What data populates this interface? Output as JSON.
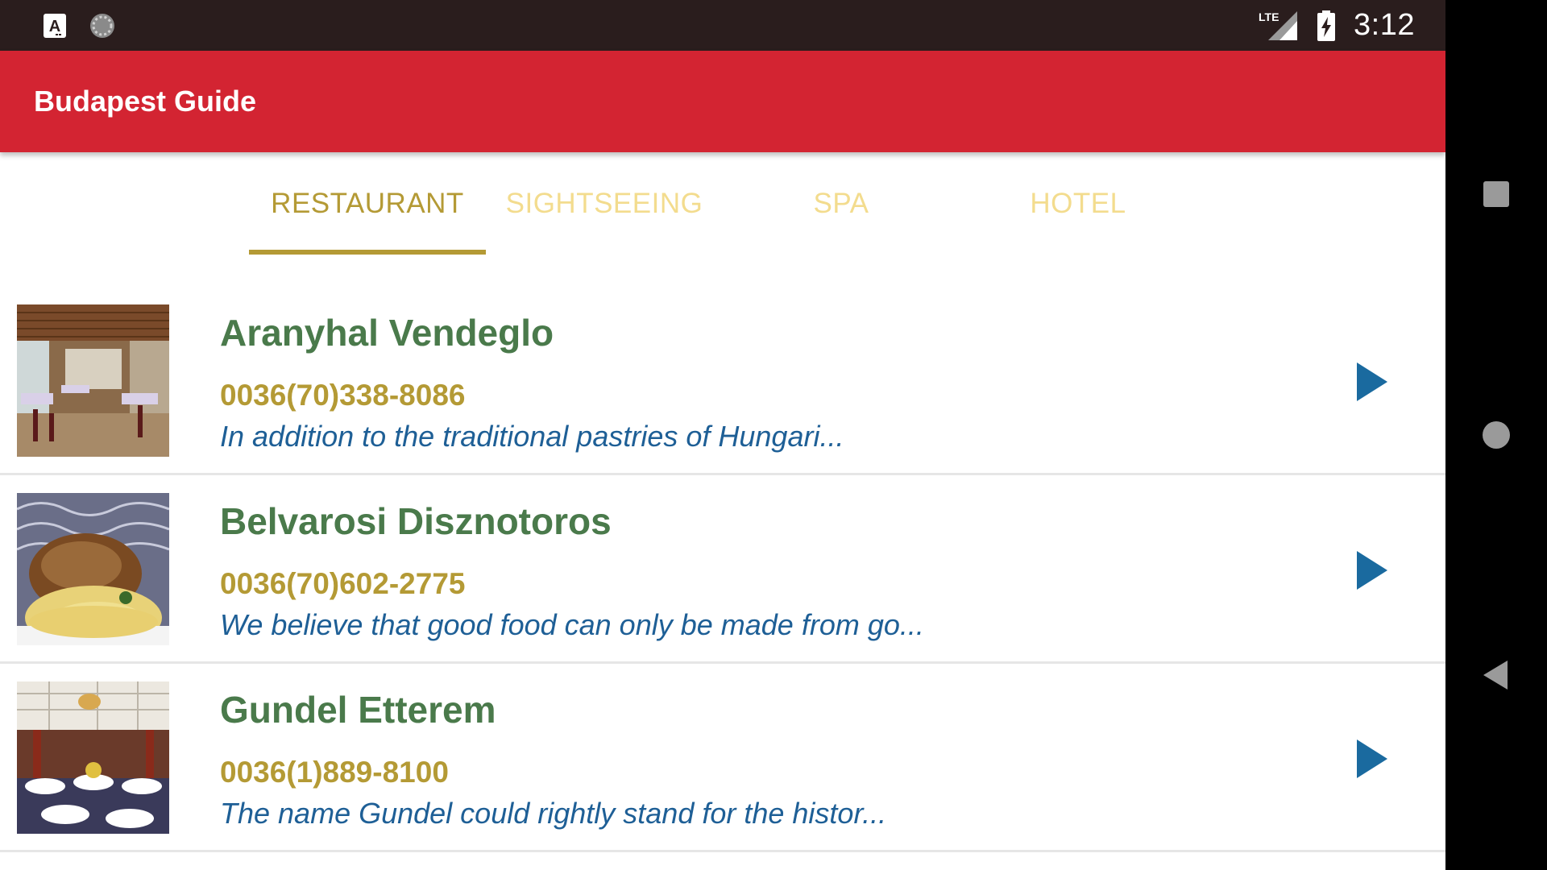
{
  "status_bar": {
    "network": "LTE",
    "time": "3:12",
    "left_icons": [
      "a-icon",
      "sync-icon"
    ]
  },
  "app_bar": {
    "title": "Budapest Guide"
  },
  "tabs": [
    {
      "label": "RESTAURANT",
      "active": true
    },
    {
      "label": "SIGHTSEEING",
      "active": false
    },
    {
      "label": "SPA",
      "active": false
    },
    {
      "label": "HOTEL",
      "active": false
    }
  ],
  "items": [
    {
      "name": "Aranyhal Vendeglo",
      "phone": "0036(70)338-8086",
      "description": "In addition to the traditional pastries of Hungari..."
    },
    {
      "name": "Belvarosi Disznotoros",
      "phone": "0036(70)602-2775",
      "description": "We believe that good food can only be made from go..."
    },
    {
      "name": "Gundel Etterem",
      "phone": "0036(1)889-8100",
      "description": "The name Gundel could rightly stand for the histor..."
    }
  ],
  "colors": {
    "app_bar": "#d32432",
    "status_bar": "#2a1d1d",
    "tab_active": "#b49a35",
    "tab_inactive": "#f3dc8e",
    "item_name": "#4a7a4b",
    "item_phone": "#b49a35",
    "item_desc": "#1e5f96",
    "arrow": "#1a6a9f"
  },
  "nav_bar": {
    "buttons": [
      "recents-icon",
      "home-icon",
      "back-icon"
    ]
  }
}
